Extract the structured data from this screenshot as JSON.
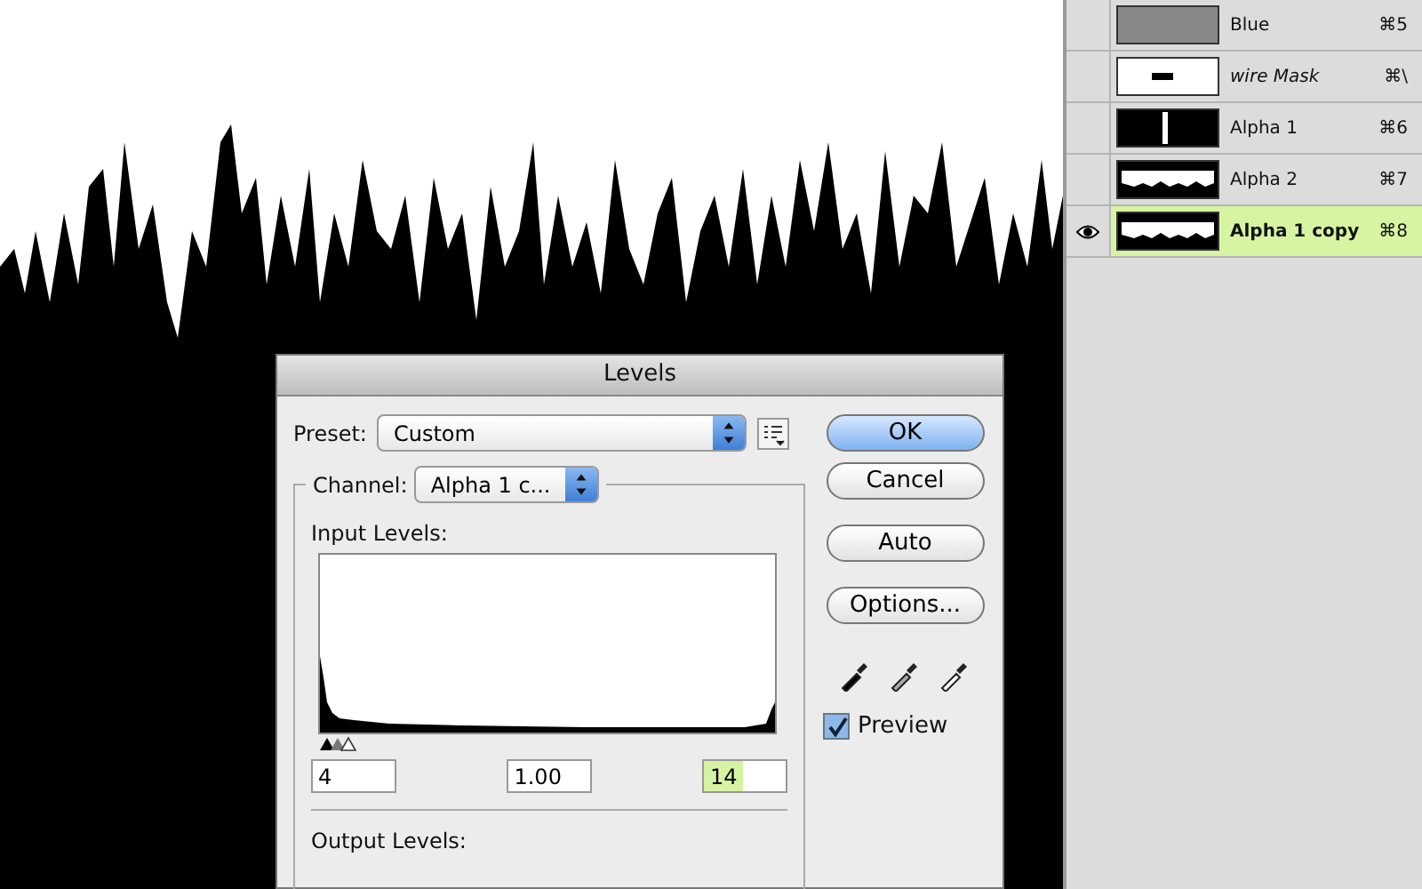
{
  "channels_panel": {
    "rows": [
      {
        "name": "Blue",
        "shortcut": "⌘5",
        "kind": "photo",
        "visible": false,
        "selected": false
      },
      {
        "name": "wire Mask",
        "shortcut": "⌘\\",
        "kind": "mask",
        "visible": false,
        "selected": false
      },
      {
        "name": "Alpha 1",
        "shortcut": "⌘6",
        "kind": "bar",
        "visible": false,
        "selected": false
      },
      {
        "name": "Alpha 2",
        "shortcut": "⌘7",
        "kind": "band",
        "visible": false,
        "selected": false
      },
      {
        "name": "Alpha 1 copy",
        "shortcut": "⌘8",
        "kind": "band",
        "visible": true,
        "selected": true
      }
    ]
  },
  "dialog": {
    "title": "Levels",
    "preset": {
      "label": "Preset:",
      "value": "Custom"
    },
    "channel": {
      "label": "Channel:",
      "value": "Alpha 1 c..."
    },
    "input_levels": {
      "label": "Input Levels:",
      "fields": [
        {
          "value": "4",
          "highlighted": false
        },
        {
          "value": "1.00",
          "highlighted": false
        },
        {
          "value": "14",
          "highlighted": true
        }
      ]
    },
    "output_levels": {
      "label": "Output Levels:"
    },
    "buttons": [
      {
        "label": "OK",
        "default": true
      },
      {
        "label": "Cancel",
        "default": false
      },
      {
        "label": "Auto",
        "default": false
      },
      {
        "label": "Options...",
        "default": false
      }
    ],
    "preview": {
      "label": "Preview",
      "checked": true
    }
  }
}
